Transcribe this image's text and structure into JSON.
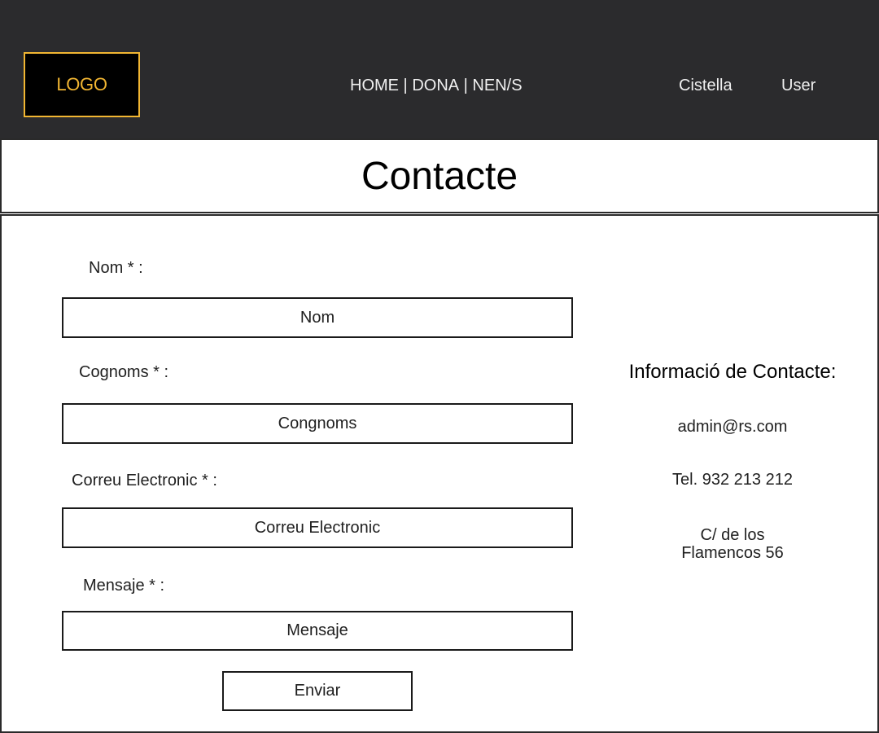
{
  "header": {
    "logo": "LOGO",
    "nav": [
      "HOME",
      "DONA",
      "NEN/S"
    ],
    "nav_separator": " | ",
    "cart": "Cistella",
    "user": "User"
  },
  "page_title": "Contacte",
  "form": {
    "name_label": "Nom * :",
    "name_placeholder": "Nom",
    "surname_label": "Cognoms * :",
    "surname_placeholder": "Congnoms",
    "email_label": "Correu Electronic * :",
    "email_placeholder": "Correu Electronic",
    "message_label": "Mensaje * :",
    "message_placeholder": "Mensaje",
    "submit": "Enviar"
  },
  "contact_info": {
    "title": "Informació de Contacte:",
    "email": "admin@rs.com",
    "phone": "Tel. 932 213 212",
    "address_line1": "C/ de los",
    "address_line2": "Flamencos 56"
  },
  "colors": {
    "header_bg": "#2b2b2d",
    "logo_accent": "#f2b632"
  }
}
